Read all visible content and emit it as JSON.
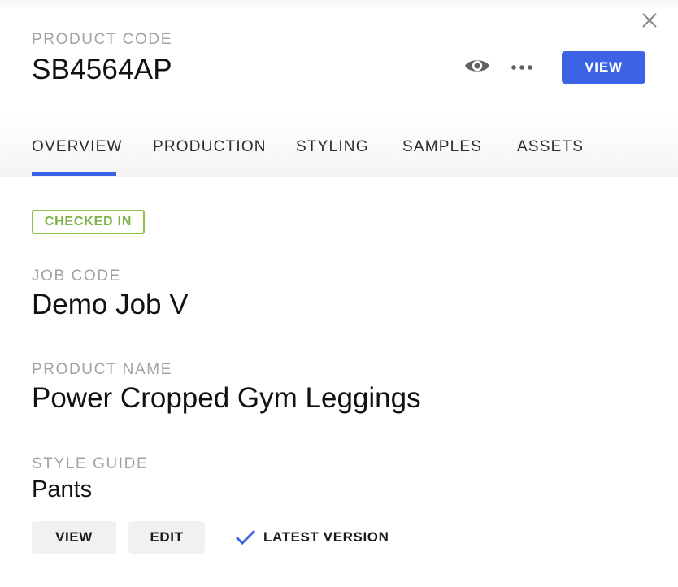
{
  "colors": {
    "accent": "#3d62e6",
    "status_green": "#8bc34a"
  },
  "header": {
    "caption": "PRODUCT CODE",
    "product_code": "SB4564AP",
    "view_label": "VIEW"
  },
  "icons": {
    "close": "close-icon",
    "preview": "eye-icon",
    "more": "more-horizontal-icon",
    "check": "check-icon"
  },
  "tabs": [
    {
      "label": "OVERVIEW",
      "active": true
    },
    {
      "label": "PRODUCTION",
      "active": false
    },
    {
      "label": "STYLING",
      "active": false
    },
    {
      "label": "SAMPLES",
      "active": false
    },
    {
      "label": "ASSETS",
      "active": false
    }
  ],
  "status_badge": "CHECKED IN",
  "fields": {
    "job_code": {
      "label": "JOB CODE",
      "value": "Demo Job V"
    },
    "product_name": {
      "label": "PRODUCT NAME",
      "value": "Power Cropped Gym Leggings"
    },
    "style_guide": {
      "label": "STYLE GUIDE",
      "value": "Pants"
    }
  },
  "style_guide_actions": {
    "view_label": "VIEW",
    "edit_label": "EDIT",
    "version_label": "LATEST VERSION"
  }
}
